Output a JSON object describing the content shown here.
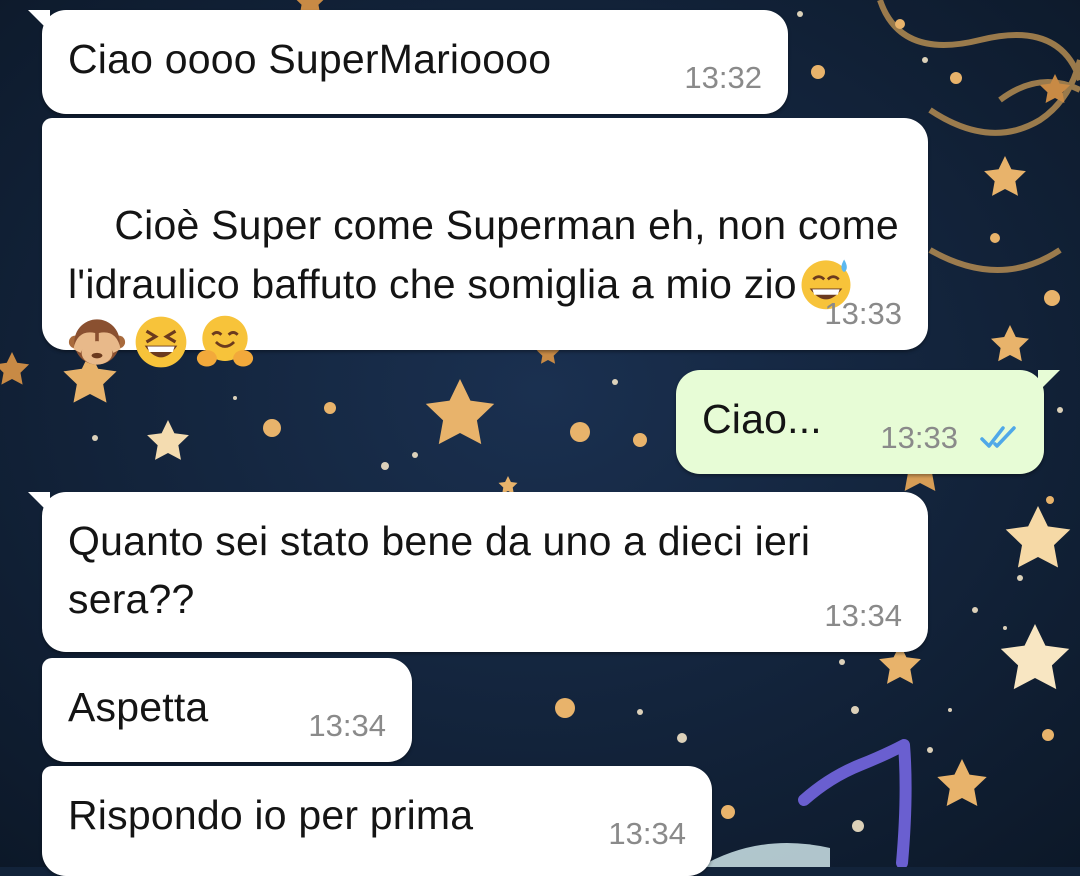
{
  "messages": [
    {
      "text": "Ciao oooo SuperMarioooo",
      "time": "13:32"
    },
    {
      "text": "Cioè Super come Superman eh, non come l'idraulico baffuto che somiglia a mio zio",
      "time": "13:33",
      "emojis": [
        "grinning-sweat-emoji",
        "see-no-evil-monkey-emoji",
        "laughing-squinting-emoji",
        "hugging-face-emoji"
      ]
    },
    {
      "text": "Ciao...",
      "time": "13:33",
      "status": "read-double-check-icon"
    },
    {
      "text": "Quanto sei stato bene da uno a dieci ieri sera??",
      "time": "13:34"
    },
    {
      "text": "Aspetta",
      "time": "13:34"
    },
    {
      "text": "Rispondo io per prima",
      "time": "13:34"
    }
  ],
  "colors": {
    "wallpaper": "#12233a",
    "incoming_bubble": "#ffffff",
    "outgoing_bubble": "#e7fcd6",
    "timestamp": "#8a8a8a",
    "read_ticks": "#4fa8e8",
    "stars": "#e8b36b",
    "annotation_stroke": "#6a5fd0"
  },
  "annotation": {
    "kind": "handwritten-number-one"
  }
}
